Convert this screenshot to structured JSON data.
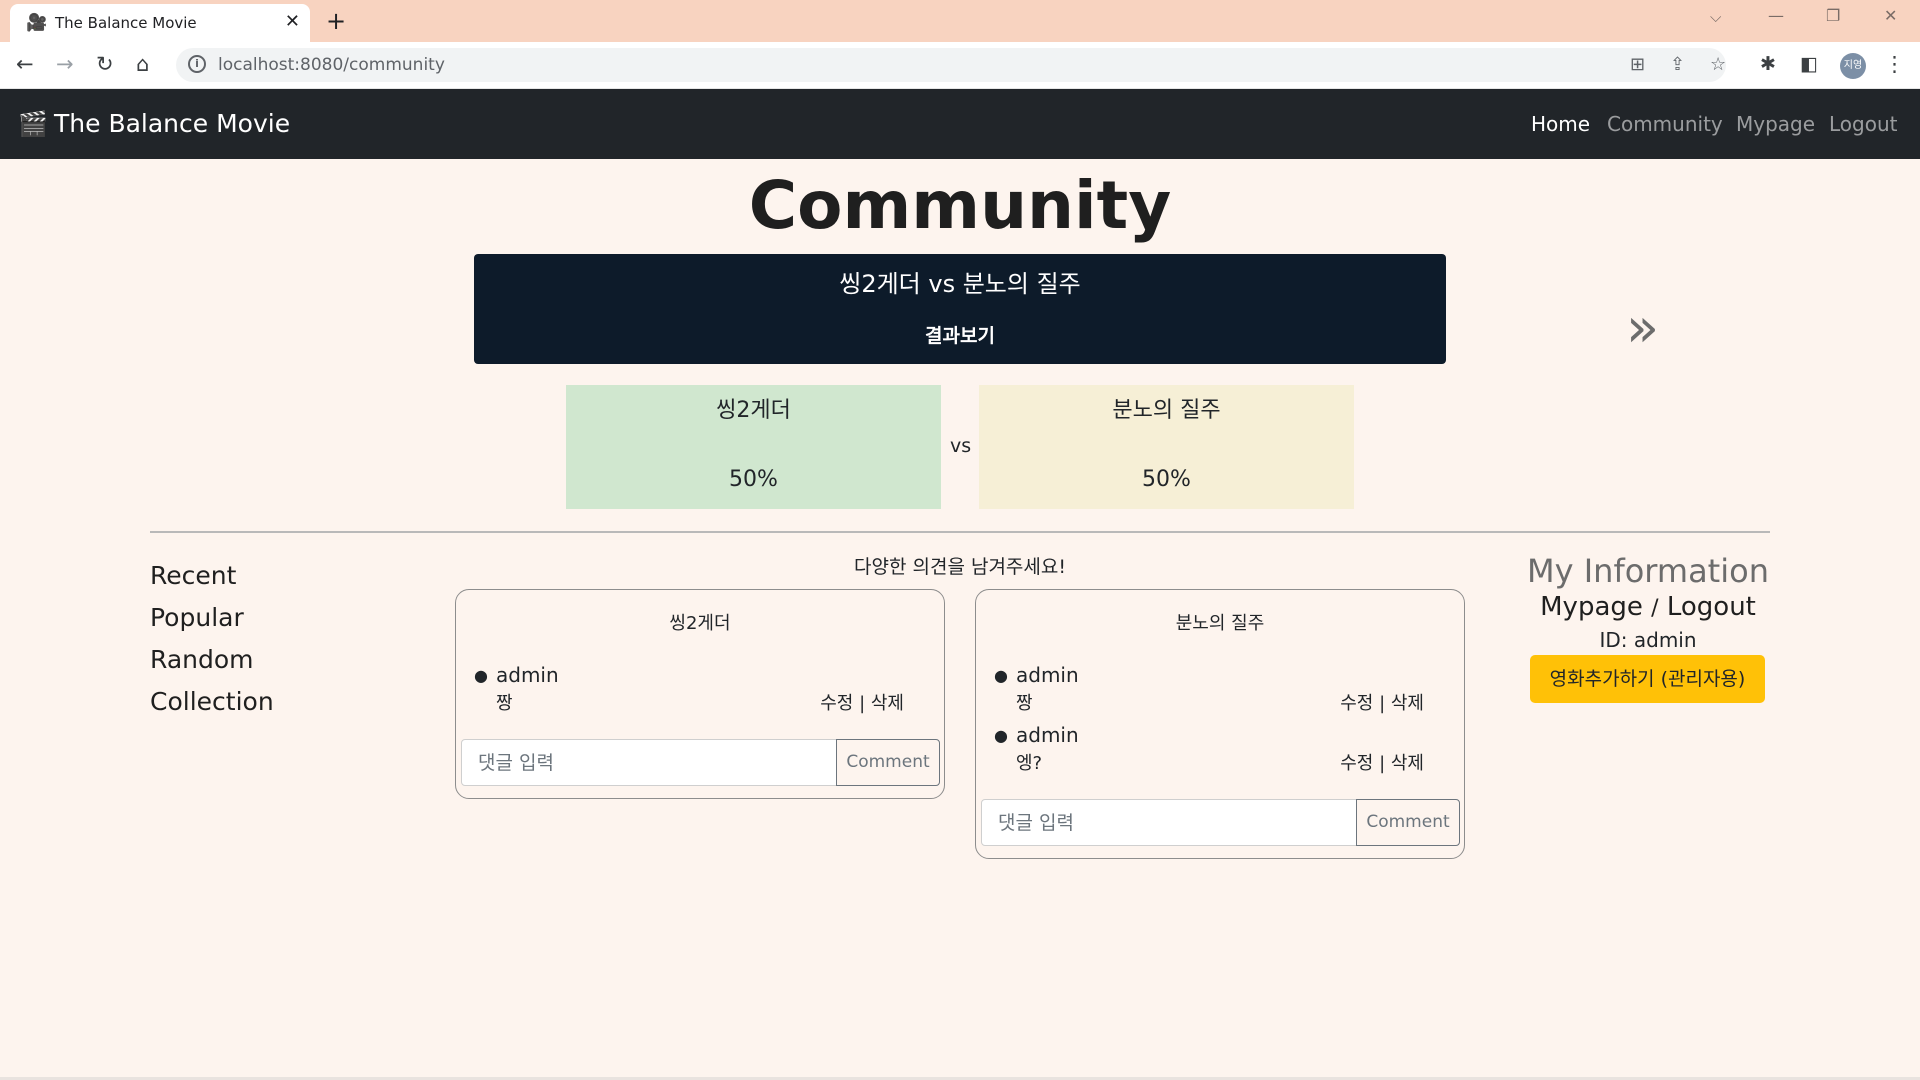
{
  "browser": {
    "tab_title": "The Balance Movie",
    "url": "localhost:8080/community",
    "profile_initials": "지영"
  },
  "navbar": {
    "brand": "The Balance Movie",
    "links": [
      "Home",
      "Community",
      "Mypage",
      "Logout"
    ],
    "active_link": "Home"
  },
  "page": {
    "title": "Community"
  },
  "matchup": {
    "title": "씽2게더 vs 분노의 질주",
    "result_label": "결과보기",
    "vs_label": "vs",
    "left": {
      "name": "씽2게더",
      "percent": "50%",
      "color": "#d0e7cf"
    },
    "right": {
      "name": "분노의 질주",
      "percent": "50%",
      "color": "#f6efd6"
    }
  },
  "sidebar": {
    "items": [
      "Recent",
      "Popular",
      "Random",
      "Collection"
    ]
  },
  "comments": {
    "prompt": "다양한 의견을 남겨주세요!",
    "input_placeholder": "댓글 입력",
    "button_label": "Comment",
    "edit_label": "수정",
    "delete_label": "삭제",
    "left": {
      "title": "씽2게더",
      "items": [
        {
          "user": "admin",
          "text": "짱"
        }
      ]
    },
    "right": {
      "title": "분노의 질주",
      "items": [
        {
          "user": "admin",
          "text": "짱"
        },
        {
          "user": "admin",
          "text": "엥?"
        }
      ]
    }
  },
  "my_info": {
    "title": "My Information",
    "mypage_label": "Mypage",
    "separator": "/",
    "logout_label": "Logout",
    "id_text": "ID: admin",
    "admin_button": "영화추가하기 (관리자용)"
  }
}
